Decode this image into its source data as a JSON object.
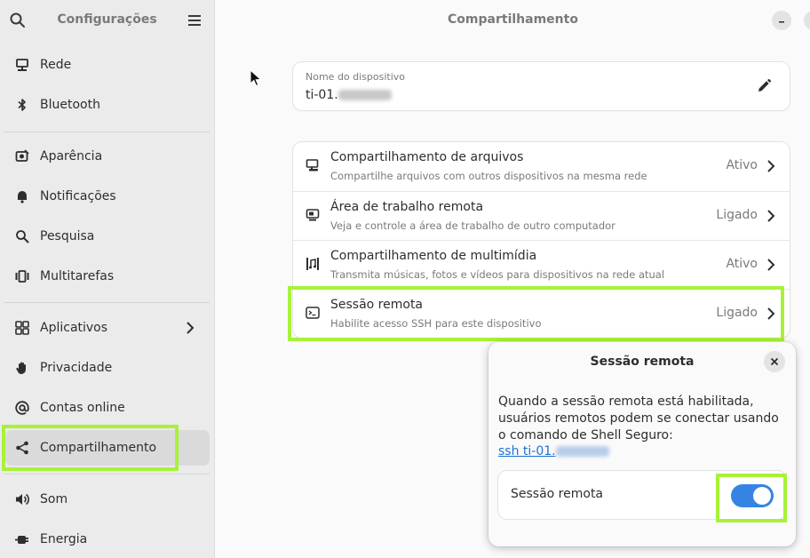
{
  "sidebar": {
    "title": "Configurações",
    "items": [
      {
        "label": "Rede",
        "icon": "network-icon"
      },
      {
        "label": "Bluetooth",
        "icon": "bluetooth-icon"
      },
      {
        "label": "Aparência",
        "icon": "appearance-icon"
      },
      {
        "label": "Notificações",
        "icon": "bell-icon"
      },
      {
        "label": "Pesquisa",
        "icon": "search-icon"
      },
      {
        "label": "Multitarefas",
        "icon": "multitasking-icon"
      },
      {
        "label": "Aplicativos",
        "icon": "apps-grid-icon"
      },
      {
        "label": "Privacidade",
        "icon": "hand-icon"
      },
      {
        "label": "Contas online",
        "icon": "at-icon"
      },
      {
        "label": "Compartilhamento",
        "icon": "share-icon"
      },
      {
        "label": "Som",
        "icon": "speaker-icon"
      },
      {
        "label": "Energia",
        "icon": "power-icon"
      }
    ],
    "active": "Compartilhamento"
  },
  "main": {
    "title": "Compartilhamento",
    "device": {
      "label": "Nome do dispositivo",
      "value_prefix": "ti-01."
    },
    "rows": [
      {
        "title": "Compartilhamento de arquivos",
        "subtitle": "Compartilhe arquivos com outros dispositivos na mesma rede",
        "status": "Ativo",
        "icon": "folder-share-icon"
      },
      {
        "title": "Área de trabalho remota",
        "subtitle": "Veja e controle a área de trabalho de outro computador",
        "status": "Ligado",
        "icon": "remote-desktop-icon"
      },
      {
        "title": "Compartilhamento de multimídia",
        "subtitle": "Transmita músicas, fotos e vídeos para dispositivos na rede atual",
        "status": "Ativo",
        "icon": "media-icon"
      },
      {
        "title": "Sessão remota",
        "subtitle": "Habilite acesso SSH para este dispositivo",
        "status": "Ligado",
        "icon": "terminal-icon"
      }
    ]
  },
  "dialog": {
    "title": "Sessão remota",
    "body": "Quando a sessão remota está habilitada, usuários remotos podem se conectar usando o comando de Shell Seguro:",
    "link_prefix": "ssh ti-01.",
    "toggle_label": "Sessão remota",
    "toggle_on": true
  },
  "colors": {
    "accent": "#3584e4",
    "highlight": "#a8f238",
    "link": "#1c71d8"
  }
}
